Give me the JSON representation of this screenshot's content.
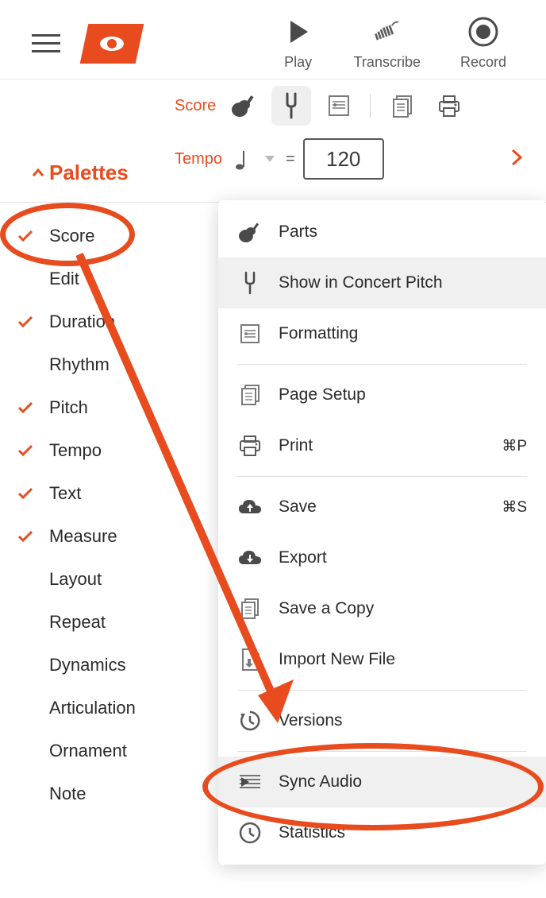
{
  "topActions": {
    "play": "Play",
    "transcribe": "Transcribe",
    "record": "Record"
  },
  "secondRow": {
    "scoreLink": "Score"
  },
  "tempoRow": {
    "label": "Tempo",
    "equals": "=",
    "value": "120"
  },
  "palettes": {
    "header": "Palettes",
    "items": [
      {
        "label": "Score",
        "checked": true
      },
      {
        "label": "Edit",
        "checked": false
      },
      {
        "label": "Duration",
        "checked": true
      },
      {
        "label": "Rhythm",
        "checked": false
      },
      {
        "label": "Pitch",
        "checked": true
      },
      {
        "label": "Tempo",
        "checked": true
      },
      {
        "label": "Text",
        "checked": true
      },
      {
        "label": "Measure",
        "checked": true
      },
      {
        "label": "Layout",
        "checked": false
      },
      {
        "label": "Repeat",
        "checked": false
      },
      {
        "label": "Dynamics",
        "checked": false
      },
      {
        "label": "Articulation",
        "checked": false
      },
      {
        "label": "Ornament",
        "checked": false
      },
      {
        "label": "Note",
        "checked": false
      }
    ]
  },
  "menu": {
    "parts": "Parts",
    "concertPitch": "Show in Concert Pitch",
    "formatting": "Formatting",
    "pageSetup": "Page Setup",
    "print": "Print",
    "printShortcut": "⌘P",
    "save": "Save",
    "saveShortcut": "⌘S",
    "export": "Export",
    "saveCopy": "Save a Copy",
    "importNew": "Import New File",
    "versions": "Versions",
    "syncAudio": "Sync Audio",
    "statistics": "Statistics"
  }
}
